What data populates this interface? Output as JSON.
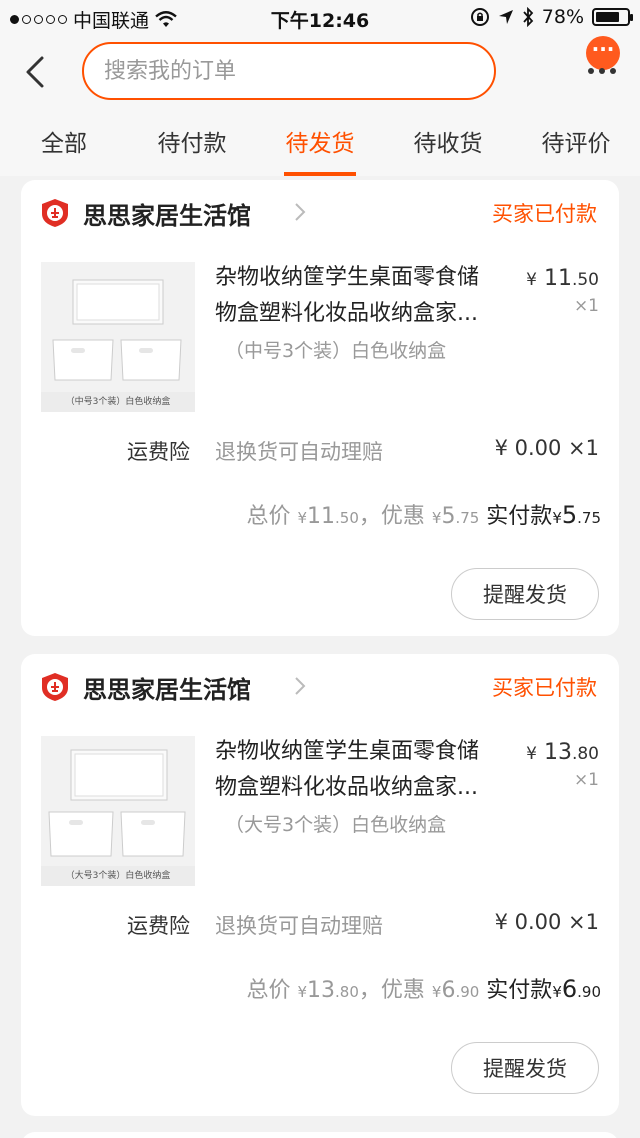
{
  "status_bar": {
    "carrier": "中国联通",
    "time": "下午12:46",
    "battery": "78%",
    "battery_level": 0.78
  },
  "search": {
    "placeholder": "搜索我的订单"
  },
  "more_badge": "···",
  "tabs": [
    {
      "label": "全部",
      "active": false
    },
    {
      "label": "待付款",
      "active": false
    },
    {
      "label": "待发货",
      "active": true
    },
    {
      "label": "待收货",
      "active": false
    },
    {
      "label": "待评价",
      "active": false
    }
  ],
  "orders": [
    {
      "shop_name": "思思家居生活馆",
      "status": "买家已付款",
      "thumb_caption": "（中号3个装）白色收纳盒",
      "title_line1": "杂物收纳筐学生桌面零食储",
      "title_line2": "物盒塑料化妆品收纳盒家...",
      "price_yen": "¥",
      "price_int": "11",
      "price_dec": ".50",
      "qty": "×1",
      "sku": "（中号3个装）白色收纳盒",
      "insurance_label": "运费险",
      "insurance_desc": "退换货可自动理赔",
      "insurance_price": "¥ 0.00 ×1",
      "total_label": "总价",
      "total_int": "11",
      "total_dec": ".50",
      "discount_label": "，优惠",
      "discount_int": "5",
      "discount_dec": ".75",
      "paid_label": "实付款",
      "paid_int": "5",
      "paid_dec": ".75",
      "button": "提醒发货"
    },
    {
      "shop_name": "思思家居生活馆",
      "status": "买家已付款",
      "thumb_caption": "（大号3个装）白色收纳盒",
      "title_line1": "杂物收纳筐学生桌面零食储",
      "title_line2": "物盒塑料化妆品收纳盒家...",
      "price_yen": "¥",
      "price_int": "13",
      "price_dec": ".80",
      "qty": "×1",
      "sku": "（大号3个装）白色收纳盒",
      "insurance_label": "运费险",
      "insurance_desc": "退换货可自动理赔",
      "insurance_price": "¥ 0.00 ×1",
      "total_label": "总价",
      "total_int": "13",
      "total_dec": ".80",
      "discount_label": "，优惠",
      "discount_int": "6",
      "discount_dec": ".90",
      "paid_label": "实付款",
      "paid_int": "6",
      "paid_dec": ".90",
      "button": "提醒发货"
    }
  ],
  "colors": {
    "accent": "#ff5000",
    "background": "#f2f2f2"
  }
}
